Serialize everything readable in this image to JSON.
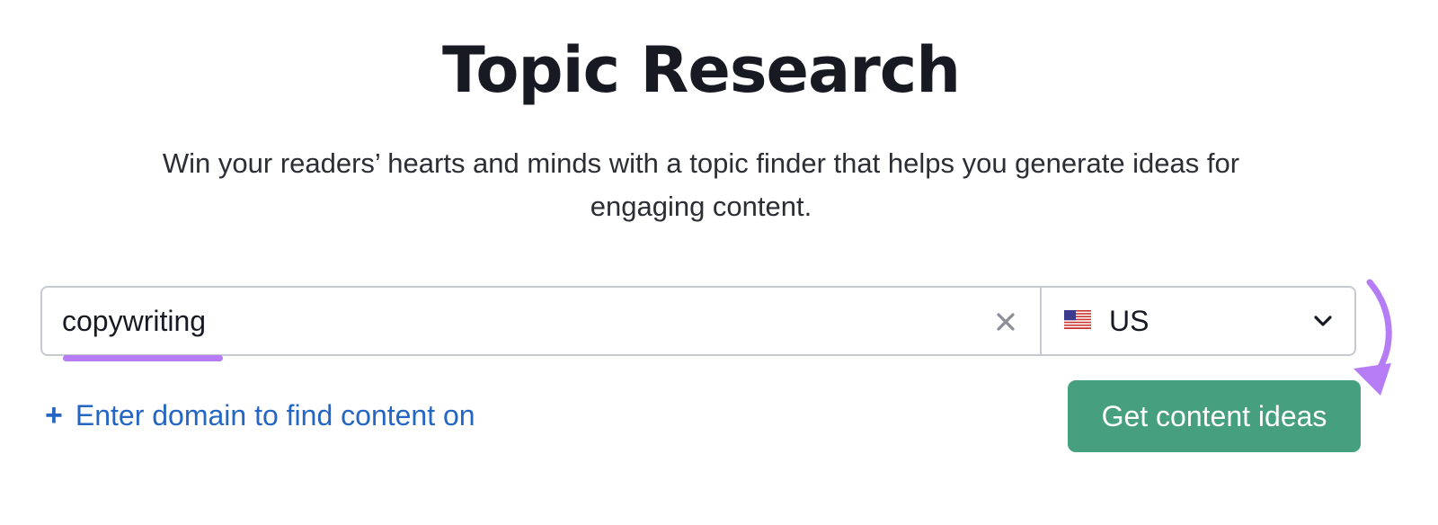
{
  "page": {
    "title": "Topic Research",
    "subtitle": "Win your readers’ hearts and minds with a topic finder that helps you generate ideas for engaging content."
  },
  "search": {
    "keyword_value": "copywriting",
    "clear_icon": "close-icon",
    "country": {
      "flag_icon": "us-flag-icon",
      "selected": "US",
      "dropdown_icon": "chevron-down-icon"
    }
  },
  "domain_link": {
    "icon": "plus-icon",
    "label": "Enter domain to find content on"
  },
  "cta": {
    "label": "Get content ideas"
  },
  "colors": {
    "title": "#171a22",
    "link": "#2466c4",
    "button": "#46a080",
    "highlight": "#b57cf5",
    "border": "#c7c9d1"
  }
}
